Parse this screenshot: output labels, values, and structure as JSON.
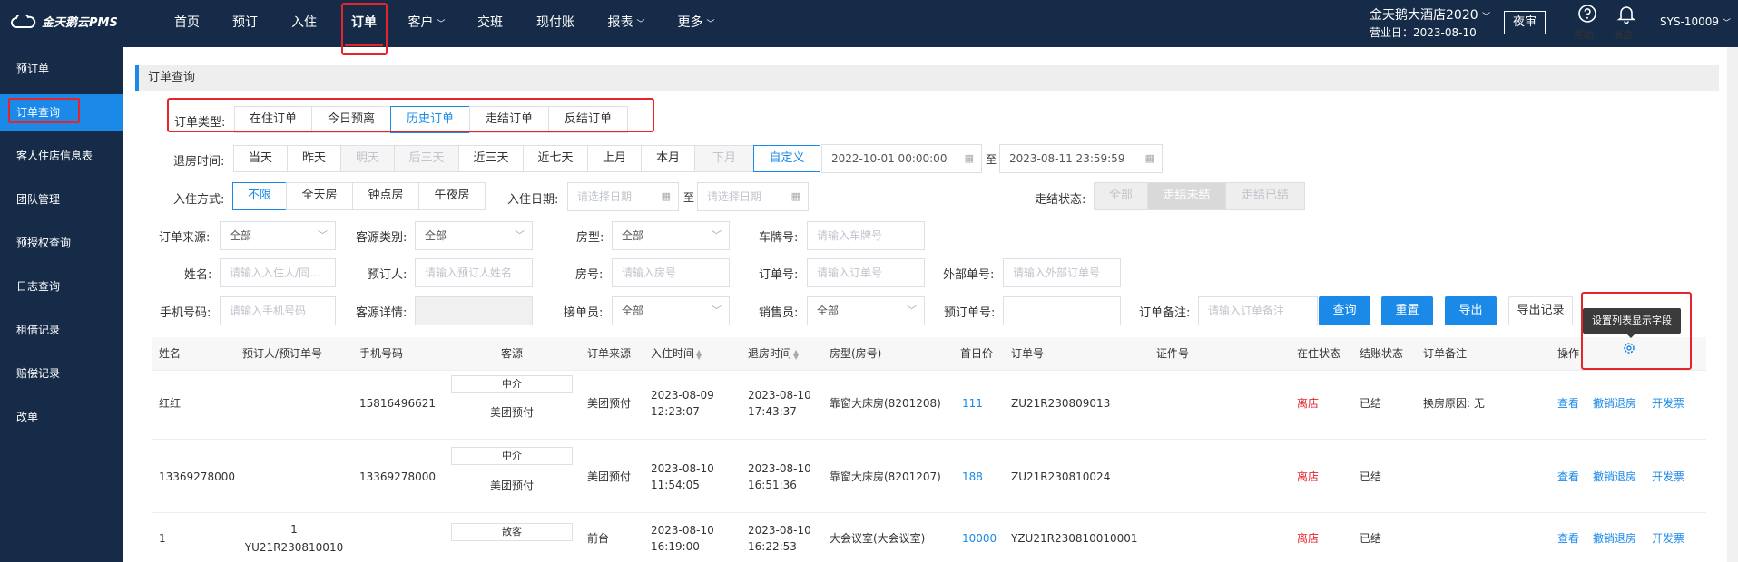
{
  "topbar": {
    "logo_text": "金天鹅云PMS",
    "nav": [
      {
        "label": "首页",
        "dropdown": false
      },
      {
        "label": "预订",
        "dropdown": false
      },
      {
        "label": "入住",
        "dropdown": false
      },
      {
        "label": "订单",
        "dropdown": false,
        "active": true
      },
      {
        "label": "客户",
        "dropdown": true
      },
      {
        "label": "交班",
        "dropdown": false
      },
      {
        "label": "现付账",
        "dropdown": false
      },
      {
        "label": "报表",
        "dropdown": true
      },
      {
        "label": "更多",
        "dropdown": true
      }
    ],
    "hotel_name": "金天鹅大酒店2020",
    "business_date": "营业日：2023-08-10",
    "night_audit": "夜审",
    "help_label": "帮助",
    "message_label": "消息",
    "user": "SYS-10009"
  },
  "sidebar": {
    "items": [
      {
        "label": "预订单",
        "active": false
      },
      {
        "label": "订单查询",
        "active": true
      },
      {
        "label": "客人住店信息表",
        "active": false
      },
      {
        "label": "团队管理",
        "active": false
      },
      {
        "label": "预授权查询",
        "active": false
      },
      {
        "label": "日志查询",
        "active": false
      },
      {
        "label": "租借记录",
        "active": false
      },
      {
        "label": "赔偿记录",
        "active": false
      },
      {
        "label": "改单",
        "active": false
      }
    ]
  },
  "main": {
    "section_title": "订单查询",
    "filters": {
      "order_type_label": "订单类型:",
      "order_types": [
        {
          "label": "在住订单",
          "selected": false
        },
        {
          "label": "今日预离",
          "selected": false
        },
        {
          "label": "历史订单",
          "selected": true
        },
        {
          "label": "走结订单",
          "selected": false
        },
        {
          "label": "反结订单",
          "selected": false
        }
      ],
      "checkout_time_label": "退房时间:",
      "checkout_options": [
        {
          "label": "当天",
          "state": "normal"
        },
        {
          "label": "昨天",
          "state": "normal"
        },
        {
          "label": "明天",
          "state": "disabled"
        },
        {
          "label": "后三天",
          "state": "disabled"
        },
        {
          "label": "近三天",
          "state": "normal"
        },
        {
          "label": "近七天",
          "state": "normal"
        },
        {
          "label": "上月",
          "state": "normal"
        },
        {
          "label": "本月",
          "state": "normal"
        },
        {
          "label": "下月",
          "state": "disabled"
        },
        {
          "label": "自定义",
          "state": "selected"
        }
      ],
      "date_from": "2022-10-01 00:00:00",
      "date_to_sep": "至",
      "date_to": "2023-08-11 23:59:59",
      "checkin_mode_label": "入住方式:",
      "checkin_modes": [
        {
          "label": "不限",
          "selected": true
        },
        {
          "label": "全天房",
          "selected": false
        },
        {
          "label": "钟点房",
          "selected": false
        },
        {
          "label": "午夜房",
          "selected": false
        }
      ],
      "checkin_date_label": "入住日期:",
      "checkin_date_placeholder": "请选择日期",
      "checkin_date_sep": "至",
      "checkout_status_label": "走结状态:",
      "checkout_status_options": [
        "全部",
        "走结未结",
        "走结已结"
      ],
      "order_source_label": "订单来源:",
      "order_source_value": "全部",
      "guest_source_type_label": "客源类别:",
      "guest_source_type_value": "全部",
      "room_type_label": "房型:",
      "room_type_value": "全部",
      "plate_label": "车牌号:",
      "plate_placeholder": "请输入车牌号",
      "name_label": "姓名:",
      "name_placeholder": "请输入入住人/同...",
      "booker_label": "预订人:",
      "booker_placeholder": "请输入预订人姓名",
      "room_no_label": "房号:",
      "room_no_placeholder": "请输入房号",
      "order_no_label": "订单号:",
      "order_no_placeholder": "请输入订单号",
      "external_no_label": "外部单号:",
      "external_no_placeholder": "请输入外部订单号",
      "phone_label": "手机号码:",
      "phone_placeholder": "请输入手机号码",
      "guest_source_detail_label": "客源详情:",
      "receiver_label": "接单员:",
      "receiver_value": "全部",
      "salesperson_label": "销售员:",
      "salesperson_value": "全部",
      "booking_no_label": "预订单号:",
      "order_remark_label": "订单备注:",
      "order_remark_placeholder": "请输入订单备注",
      "query_button": "查询",
      "reset_button": "重置",
      "export_button": "导出",
      "export_log_button": "导出记录"
    },
    "tooltip": "设置列表显示字段",
    "table": {
      "headers": {
        "name": "姓名",
        "booker": "预订人/预订单号",
        "phone": "手机号码",
        "source": "客源",
        "order_source": "订单来源",
        "checkin_time": "入住时间",
        "checkout_time": "退房时间",
        "room": "房型(房号)",
        "first_price": "首日价",
        "order_no": "订单号",
        "id_no": "证件号",
        "stay_status": "在住状态",
        "settle_status": "结账状态",
        "remark": "订单备注",
        "actions": "操作"
      },
      "rows": [
        {
          "name": "红红",
          "booker": "",
          "booker_no": "",
          "phone": "15816496621",
          "source_tag": "中介",
          "source_name": "美团预付",
          "order_source": "美团预付",
          "checkin_date": "2023-08-09",
          "checkin_time": "12:23:07",
          "checkout_date": "2023-08-10",
          "checkout_time": "17:43:37",
          "room": "靠窗大床房(8201208)",
          "first_price": "111",
          "order_no": "ZU21R230809013",
          "stay_status": "离店",
          "settle_status": "已结",
          "remark": "换房原因: 无",
          "actions": [
            "查看",
            "撤销退房",
            "开发票"
          ]
        },
        {
          "name": "13369278000",
          "booker": "",
          "booker_no": "",
          "phone": "13369278000",
          "source_tag": "中介",
          "source_name": "美团预付",
          "order_source": "美团预付",
          "checkin_date": "2023-08-10",
          "checkin_time": "11:54:05",
          "checkout_date": "2023-08-10",
          "checkout_time": "16:51:36",
          "room": "靠窗大床房(8201207)",
          "first_price": "188",
          "order_no": "ZU21R230810024",
          "stay_status": "离店",
          "settle_status": "已结",
          "remark": "",
          "actions": [
            "查看",
            "撤销退房",
            "开发票"
          ]
        },
        {
          "name": "1",
          "booker": "1",
          "booker_no": "YU21R230810010",
          "phone": "",
          "source_tag": "散客",
          "source_name": "",
          "order_source": "前台",
          "checkin_date": "2023-08-10",
          "checkin_time": "16:19:00",
          "checkout_date": "2023-08-10",
          "checkout_time": "16:22:53",
          "room": "大会议室(大会议室)",
          "first_price": "10000",
          "order_no": "YZU21R230810010001",
          "stay_status": "离店",
          "settle_status": "已结",
          "remark": "",
          "actions": [
            "查看",
            "撤销退房",
            "开发票"
          ]
        }
      ]
    }
  },
  "colors": {
    "topbar_bg": "#152b47",
    "accent": "#1b89e8",
    "highlight_red": "#e5242b"
  }
}
